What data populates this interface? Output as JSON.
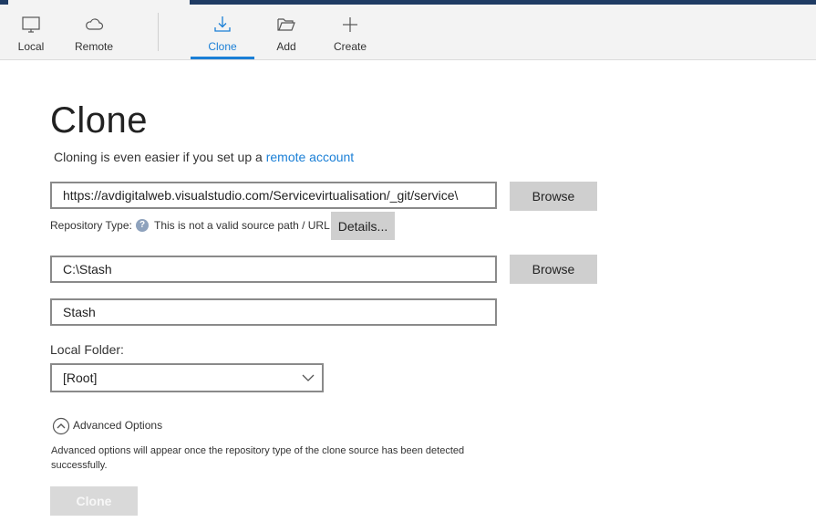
{
  "toolbar": {
    "items": [
      {
        "label": "Local",
        "icon": "monitor-icon"
      },
      {
        "label": "Remote",
        "icon": "cloud-icon"
      },
      {
        "label": "Clone",
        "icon": "download-icon",
        "active": true
      },
      {
        "label": "Add",
        "icon": "folder-open-icon"
      },
      {
        "label": "Create",
        "icon": "plus-icon"
      }
    ]
  },
  "page": {
    "title": "Clone",
    "subtitle_prefix": "Cloning is even easier if you set up a",
    "subtitle_link": "remote account"
  },
  "source": {
    "url_value": "https://avdigitalweb.visualstudio.com/Servicevirtualisation/_git/service\\",
    "browse_label": "Browse",
    "repo_type_label": "Repository Type:",
    "repo_type_message": "This is not a valid source path / URL",
    "details_label": "Details..."
  },
  "destination": {
    "path_value": "C:\\Stash",
    "browse_label": "Browse",
    "name_value": "Stash"
  },
  "local_folder": {
    "label": "Local Folder:",
    "selected": "[Root]"
  },
  "advanced": {
    "label": "Advanced Options",
    "description": "Advanced options will appear once the repository type of the clone source has been detected successfully."
  },
  "actions": {
    "clone_label": "Clone"
  },
  "colors": {
    "accent": "#1a7fd6",
    "titlebar": "#1f3b63",
    "toolbar_bg": "#f3f3f3",
    "button_bg": "#cfcfcf"
  }
}
